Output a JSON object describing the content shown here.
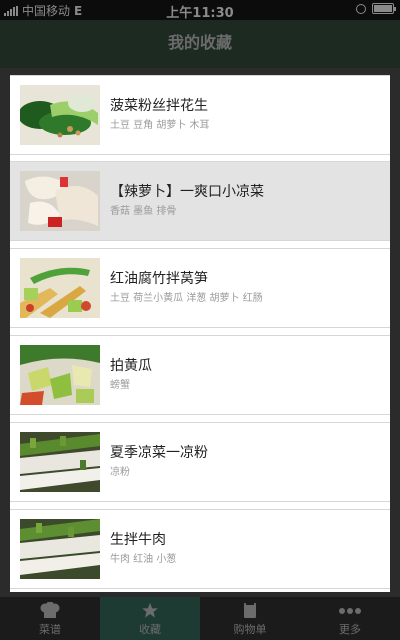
{
  "status_bar": {
    "carrier": "中国移动",
    "network": "E",
    "time": "上午11:30"
  },
  "header": {
    "title": "我的收藏"
  },
  "favorites": [
    {
      "title": "菠菜粉丝拌花生",
      "ingredients": "土豆  豆角  胡萝卜  木耳"
    },
    {
      "title": "【辣萝卜】一爽口小凉菜",
      "ingredients": "香菇  墨鱼  排骨"
    },
    {
      "title": "红油腐竹拌莴笋",
      "ingredients": "土豆  荷兰小黄瓜  洋葱  胡萝卜  红肠"
    },
    {
      "title": "拍黄瓜",
      "ingredients": "螃蟹"
    },
    {
      "title": "夏季凉菜一凉粉",
      "ingredients": "凉粉"
    },
    {
      "title": "生拌牛肉",
      "ingredients": "牛肉 红油 小葱"
    }
  ],
  "tabbar": {
    "items": [
      {
        "label": "菜谱",
        "icon": "chef-hat-icon"
      },
      {
        "label": "收藏",
        "icon": "star-icon"
      },
      {
        "label": "购物单",
        "icon": "shopping-list-icon"
      },
      {
        "label": "更多",
        "icon": "more-dots-icon"
      }
    ],
    "active_index": 1
  }
}
